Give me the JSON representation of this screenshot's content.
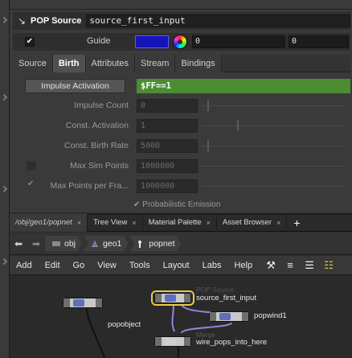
{
  "param_pane": {
    "op_type": "POP Source",
    "node_name": "source_first_input",
    "guide_label": "Guide",
    "guide_checked": true,
    "guide_color": "#1414b8",
    "guide_values": [
      "0",
      "0"
    ],
    "tabs": [
      "Source",
      "Birth",
      "Attributes",
      "Stream",
      "Bindings"
    ],
    "active_tab": "Birth",
    "impulse_activation_label": "Impulse Activation",
    "impulse_activation_expr": "$FF==1",
    "rows": [
      {
        "label": "Impulse Count",
        "value": "0"
      },
      {
        "label": "Const. Activation",
        "value": "1"
      },
      {
        "label": "Const. Birth Rate",
        "value": "5000"
      },
      {
        "label": "Max Sim Points",
        "value": "1000000"
      },
      {
        "label": "Max Points per Fra...",
        "value": "1000000"
      }
    ],
    "probabilistic_label": "Probabilistic Emission"
  },
  "pane_tabs": {
    "items": [
      {
        "label": "/obj/geo1/popnet"
      },
      {
        "label": "Tree View"
      },
      {
        "label": "Material Palette"
      },
      {
        "label": "Asset Browser"
      }
    ],
    "close_glyph": "×",
    "add_glyph": "+"
  },
  "path_bar": {
    "crumbs": [
      {
        "label": "obj"
      },
      {
        "label": "geo1"
      },
      {
        "label": "popnet"
      }
    ]
  },
  "menu_bar": {
    "items": [
      "Add",
      "Edit",
      "Go",
      "View",
      "Tools",
      "Layout",
      "Labs",
      "Help"
    ]
  },
  "network": {
    "nodes": [
      {
        "type": "POP Source",
        "name": "source_first_input"
      },
      {
        "type": "",
        "name": "popwind1"
      },
      {
        "type": "",
        "name": "popobject"
      },
      {
        "type": "Merge",
        "name": "wire_pops_into_here"
      }
    ]
  },
  "colors": {
    "expression_green": "#4c8d34",
    "selected_node": "#e8c847",
    "wire_purple": "#9b7fe0"
  }
}
